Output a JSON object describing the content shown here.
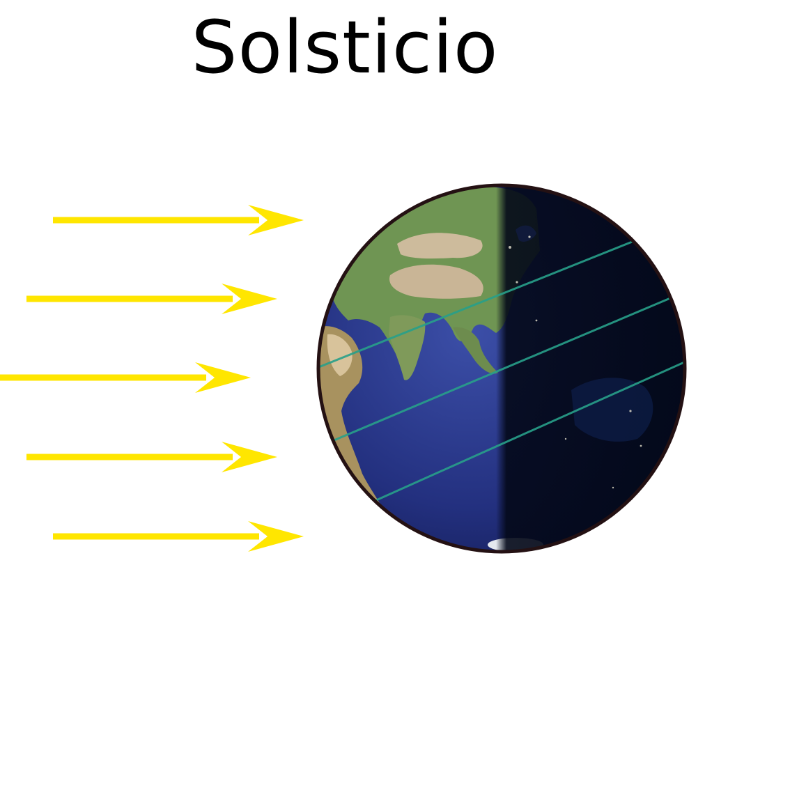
{
  "title": "Solsticio",
  "colors": {
    "sun_rays": "#ffe600",
    "ocean": "#23307f",
    "land": "#6f9553",
    "desert": "#c9b596",
    "night": "#030818",
    "latitude_lines": "#28a08a",
    "outline": "#241113"
  },
  "icons": {
    "ray": "arrow-right-icon",
    "earth": "globe-icon"
  }
}
